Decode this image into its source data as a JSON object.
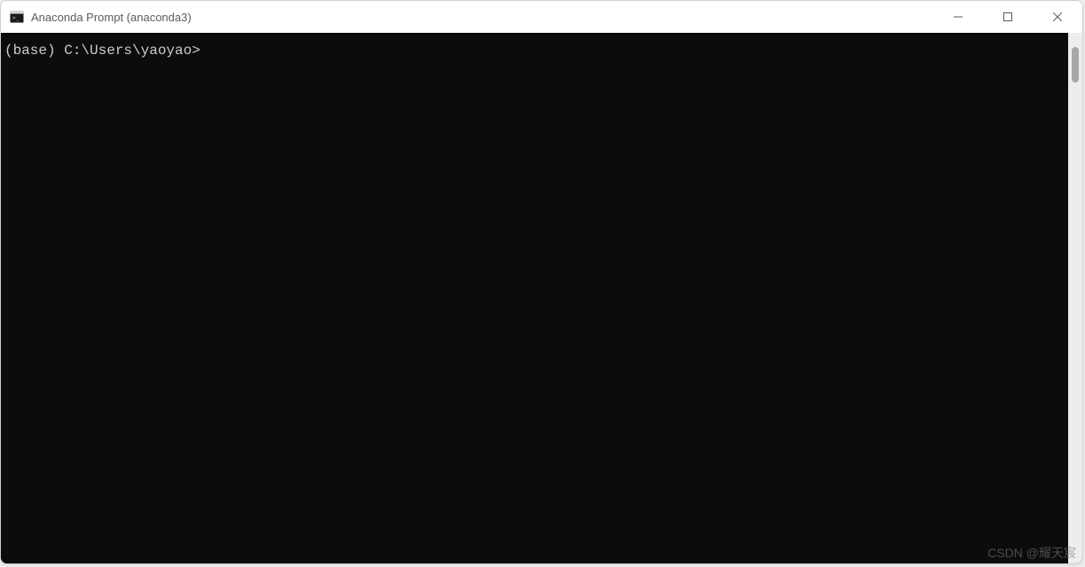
{
  "window": {
    "title": "Anaconda Prompt (anaconda3)"
  },
  "terminal": {
    "prompt": "(base) C:\\Users\\yaoyao>"
  },
  "watermark": {
    "text": "CSDN @耀天宸"
  },
  "colors": {
    "terminal_bg": "#0c0c0c",
    "terminal_fg": "#cccccc",
    "titlebar_bg": "#ffffff",
    "title_fg": "#5c5c5c"
  }
}
